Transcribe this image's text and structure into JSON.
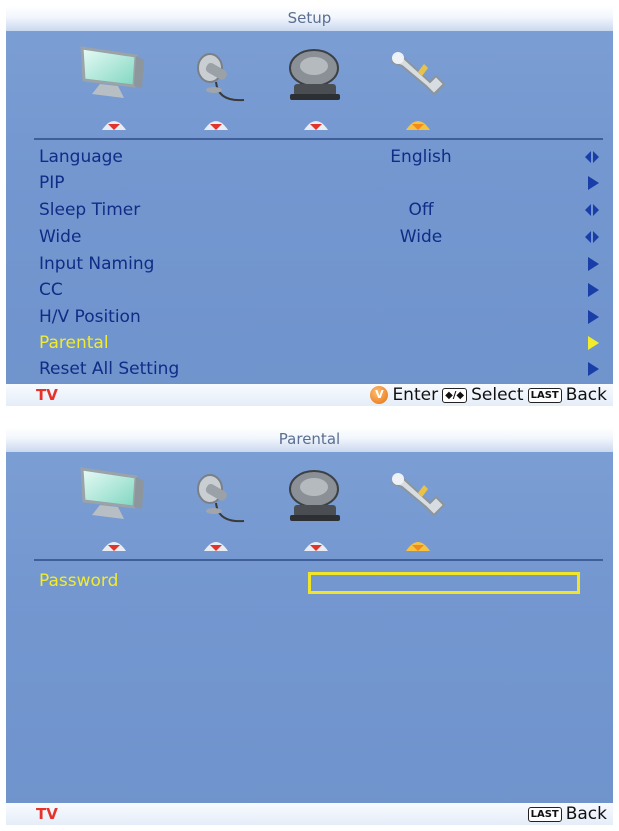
{
  "setup": {
    "title": "Setup",
    "icons": [
      "monitor-icon",
      "satellite-dish-icon",
      "speaker-icon",
      "wrench-icon"
    ],
    "menu": [
      {
        "label": "Language",
        "value": "English",
        "control": "left-right"
      },
      {
        "label": "PIP",
        "value": "",
        "control": "right"
      },
      {
        "label": "Sleep Timer",
        "value": "Off",
        "control": "left-right"
      },
      {
        "label": "Wide",
        "value": "Wide",
        "control": "left-right"
      },
      {
        "label": "Input Naming",
        "value": "",
        "control": "right"
      },
      {
        "label": "CC",
        "value": "",
        "control": "right"
      },
      {
        "label": "H/V Position",
        "value": "",
        "control": "right"
      },
      {
        "label": "Parental",
        "value": "",
        "control": "right",
        "active": true
      },
      {
        "label": "Reset All Setting",
        "value": "",
        "control": "right"
      }
    ],
    "footer": {
      "source": "TV",
      "enter_label": "Enter",
      "select_key": "◆/◆",
      "select_label": "Select",
      "back_key": "LAST",
      "back_label": "Back",
      "logo": "V"
    }
  },
  "parental": {
    "title": "Parental",
    "password_label": "Password",
    "password_value": "",
    "footer": {
      "source": "TV",
      "back_key": "LAST",
      "back_label": "Back"
    }
  },
  "colors": {
    "panel_bg": "#7497d0",
    "menu_text": "#102c86",
    "active_text": "#f2ec2a",
    "arrow": "#1a3ea8",
    "tv_label": "#e6332a",
    "separator": "#3f5f9a"
  }
}
